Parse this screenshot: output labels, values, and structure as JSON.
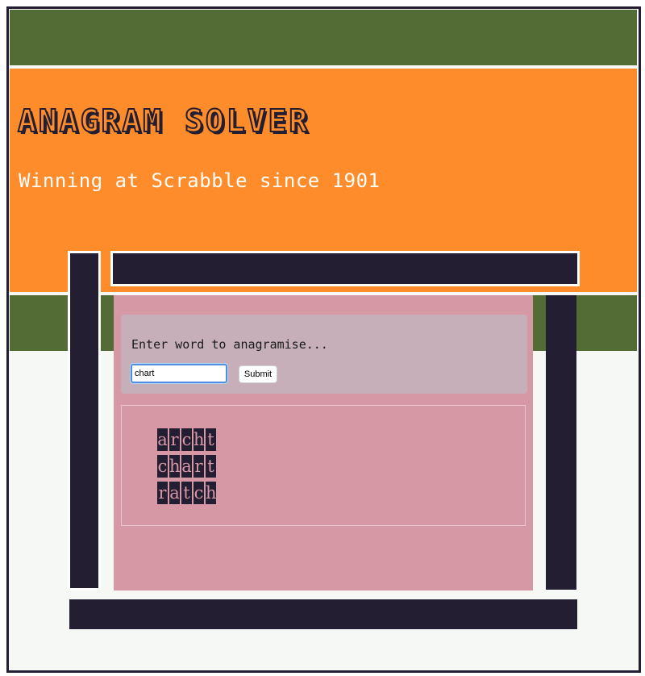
{
  "header": {
    "title": "ANAGRAM SOLVER",
    "subtitle": "Winning at Scrabble since 1901"
  },
  "form": {
    "prompt": "Enter word to anagramise...",
    "input_value": "chart",
    "submit_label": "Submit"
  },
  "results": [
    [
      "a",
      "r",
      "c",
      "h",
      "t"
    ],
    [
      "c",
      "h",
      "a",
      "r",
      "t"
    ],
    [
      "r",
      "a",
      "t",
      "c",
      "h"
    ]
  ],
  "colors": {
    "orange": "#ff8c2a",
    "green": "#536c35",
    "dark": "#231e32",
    "pink": "#d698a4",
    "mauve": "#c6afb8",
    "background": "#f6f8f5"
  }
}
